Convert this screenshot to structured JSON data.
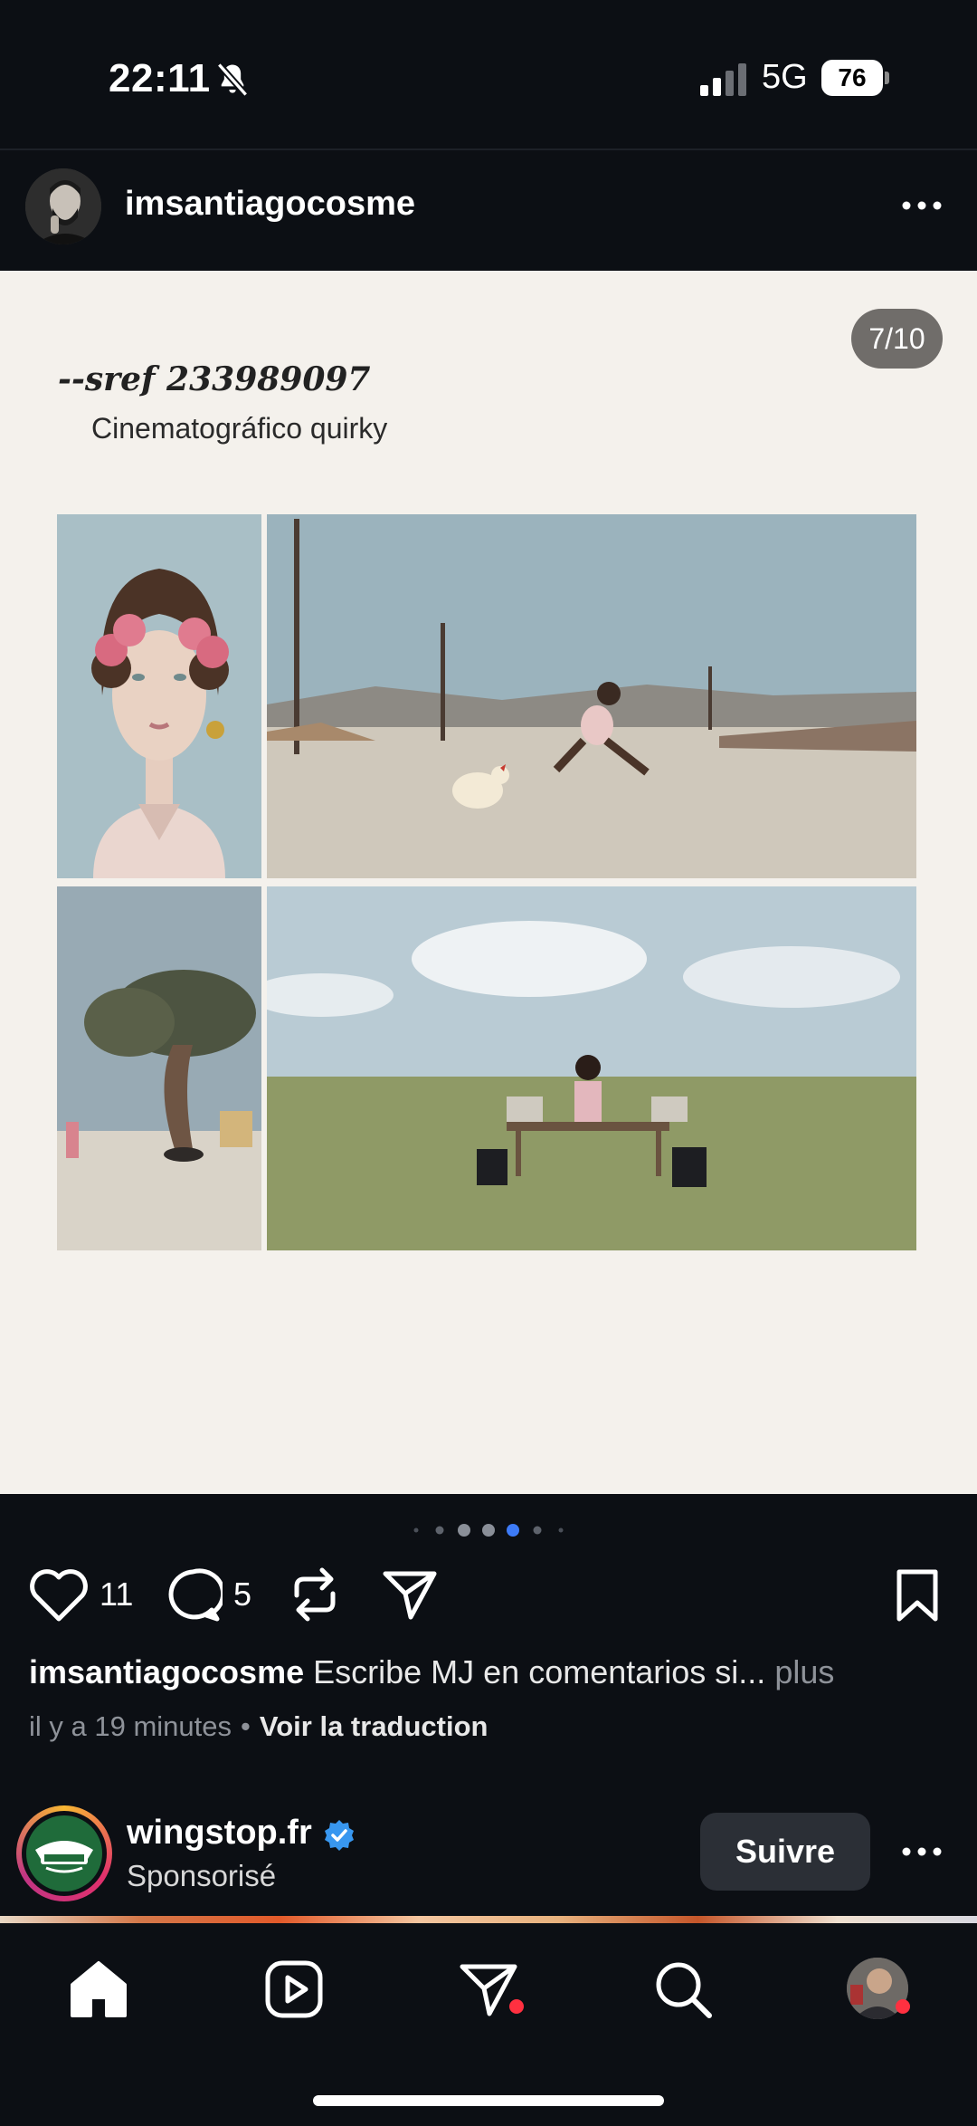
{
  "status_bar": {
    "time": "22:11",
    "network": "5G",
    "battery": "76"
  },
  "post": {
    "author": "imsantiagocosme",
    "page_indicator": "7/10",
    "card": {
      "sref_code": "--sref 233989097",
      "caption": "Cinematográfico quirky"
    },
    "photos": [
      "portrait-flowers",
      "child-chicken-run",
      "tree-desert",
      "dj-field"
    ],
    "carousel": {
      "count": 7,
      "active_index": 4
    },
    "likes": "11",
    "comments": "5",
    "caption_author": "imsantiagocosme",
    "caption_text": "Escribe MJ en comentarios si...",
    "caption_more": "plus",
    "time_ago": "il y a 19 minutes",
    "meta_separator": "•",
    "translate": "Voir la traduction"
  },
  "sponsored": {
    "name": "wingstop.fr",
    "label": "Sponsorisé",
    "follow": "Suivre"
  },
  "nav": {
    "items": [
      "home-icon",
      "reels-icon",
      "messages-icon",
      "search-icon",
      "profile-avatar"
    ],
    "active": "home"
  },
  "colors": {
    "background": "#0c0f14",
    "card": "#f4f1ec",
    "active_dot": "#3d7bf7",
    "verified": "#3897f0",
    "notification": "#ff3040"
  }
}
